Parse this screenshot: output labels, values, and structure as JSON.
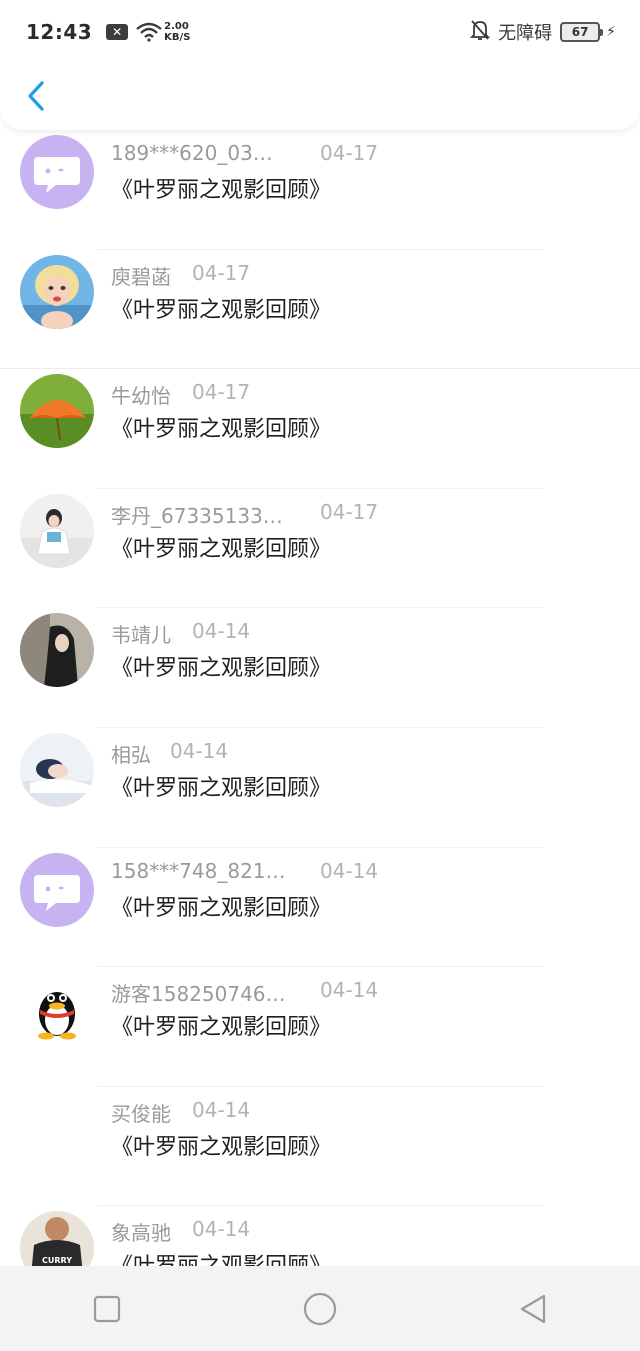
{
  "status_bar": {
    "time": "12:43",
    "net_speed_value": "2.00",
    "net_speed_unit": "KB/S",
    "accessibility": "无障碍",
    "battery": "67"
  },
  "header": {
    "back_icon": "chevron-left-icon",
    "accent": "#1e9be8"
  },
  "messages": [
    {
      "name": "189***620_03…",
      "date": "04-17",
      "title": "《叶罗丽之观影回顾》",
      "avatar": "purple-chat-bubble"
    },
    {
      "name": "庾碧菡",
      "date": "04-17",
      "title": "《叶罗丽之观影回顾》",
      "avatar": "pinup-illustration"
    },
    {
      "name": "牛幼怡",
      "date": "04-17",
      "title": "《叶罗丽之观影回顾》",
      "avatar": "orange-umbrella-on-grass"
    },
    {
      "name": "李丹_67335133…",
      "date": "04-17",
      "title": "《叶罗丽之观影回顾》",
      "avatar": "girl-photo"
    },
    {
      "name": "韦靖儿",
      "date": "04-14",
      "title": "《叶罗丽之观影回顾》",
      "avatar": "dark-hair-girl"
    },
    {
      "name": "相弘",
      "date": "04-14",
      "title": "《叶罗丽之观影回顾》",
      "avatar": "sleeping-person"
    },
    {
      "name": "158***748_821…",
      "date": "04-14",
      "title": "《叶罗丽之观影回顾》",
      "avatar": "purple-chat-bubble"
    },
    {
      "name": "游客158250746…",
      "date": "04-14",
      "title": "《叶罗丽之观影回顾》",
      "avatar": "qq-penguin"
    },
    {
      "name": "买俊能",
      "date": "04-14",
      "title": "《叶罗丽之观影回顾》",
      "avatar": "none"
    },
    {
      "name": "象高驰",
      "date": "04-14",
      "title": "《叶罗丽之观影回顾》",
      "avatar": "basketball-jersey"
    }
  ],
  "nav_bar": {
    "recent_icon": "square-icon",
    "home_icon": "circle-icon",
    "back_icon": "triangle-back-icon"
  }
}
